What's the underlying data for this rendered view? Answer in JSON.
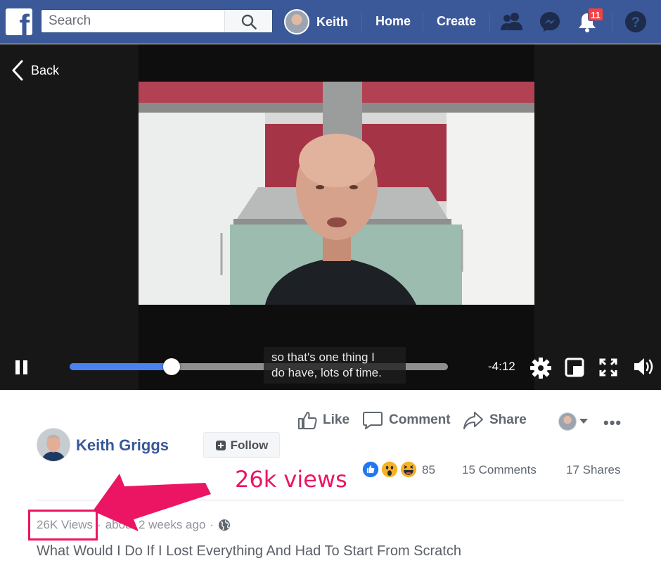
{
  "topbar": {
    "logo": "f",
    "search_placeholder": "Search",
    "profile_name": "Keith",
    "home_label": "Home",
    "create_label": "Create",
    "notifications_count": "11",
    "icons": [
      "friends-icon",
      "messenger-icon",
      "notifications-icon",
      "help-icon"
    ]
  },
  "video": {
    "back_label": "Back",
    "caption_line1": "so that's one thing I",
    "caption_line2": "do have, lots of time.",
    "time_remaining": "-4:12",
    "progress_fraction": 0.27
  },
  "post": {
    "actions": {
      "like_label": "Like",
      "comment_label": "Comment",
      "share_label": "Share"
    },
    "author_name": "Keith Griggs",
    "follow_label": "Follow",
    "reaction_count": "85",
    "comments_label": "15 Comments",
    "shares_label": "17 Shares",
    "views_label": "26K Views",
    "time_label": "about 2 weeks ago",
    "title": "What Would I Do If I Lost Everything And Had To Start From Scratch"
  },
  "annotation": {
    "text": "26k views",
    "color": "#ec1563"
  },
  "colors": {
    "brand": "#3b5998",
    "progress": "#4a81f0",
    "link": "#385898"
  }
}
